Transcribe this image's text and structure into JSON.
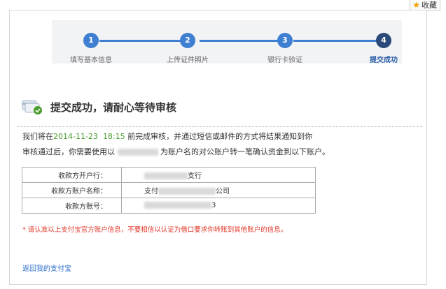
{
  "favorite": {
    "icon": "star-icon",
    "label": "收藏"
  },
  "steps": [
    {
      "num": "1",
      "label": "填写基本信息"
    },
    {
      "num": "2",
      "label": "上传证件照片"
    },
    {
      "num": "3",
      "label": "银行卡验证"
    },
    {
      "num": "4",
      "label": "提交成功"
    }
  ],
  "colors": {
    "step_blue": "#3e7fd1",
    "step_current": "#2a4a7a",
    "accent_green": "#4a9d2e",
    "warning_red": "#e03a2c",
    "link_blue": "#2a6cc8"
  },
  "result": {
    "icon": "card-check-icon",
    "title": "提交成功，请耐心等待审核"
  },
  "message": {
    "line1_prefix": "我们将在",
    "date": "2014-11-23",
    "time": "18:15",
    "line1_suffix": "前完成审核，并通过短信或邮件的方式将结果通知到你",
    "line2_prefix": "审核通过后，你需要使用以",
    "line2_suffix": "为账户名的对公账户转一笔确认资金到以下账户。"
  },
  "account_table": {
    "rows": [
      {
        "label": "收款方开户行：",
        "value_prefix": "",
        "value_suffix": "支行"
      },
      {
        "label": "收款方账户名称：",
        "value_prefix": "支付",
        "value_suffix": "公司"
      },
      {
        "label": "收款方账号：",
        "value_prefix": "",
        "value_suffix": "3"
      }
    ]
  },
  "warning": "* 请认准以上支付宝官方账户信息，不要相信以认证为借口要求你转账到其他账户的信息。",
  "back_link": "返回我的支付宝"
}
